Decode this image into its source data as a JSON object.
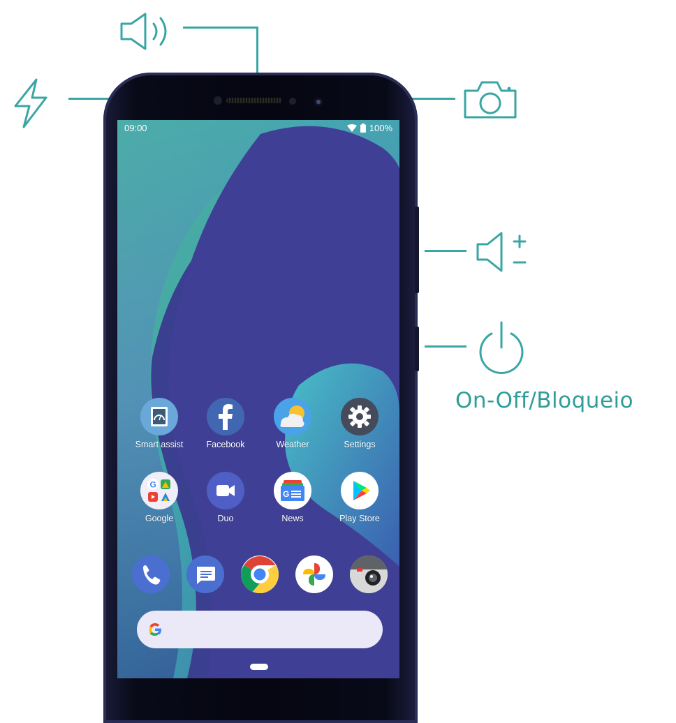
{
  "callouts": {
    "speaker_icon": "speaker-icon",
    "flash_icon": "flash-icon",
    "camera_icon": "camera-icon",
    "volume_icon": "volume-icon",
    "power_icon": "power-icon",
    "power_label": "On-Off/Bloqueio",
    "accent_color": "#3aa6a4"
  },
  "status_bar": {
    "time": "09:00",
    "battery": "100%",
    "wifi_icon": "wifi-icon",
    "battery_icon": "battery-icon"
  },
  "apps_row1": [
    {
      "label": "Smart assist",
      "icon": "smart-assist-icon"
    },
    {
      "label": "Facebook",
      "icon": "facebook-icon"
    },
    {
      "label": "Weather",
      "icon": "weather-icon"
    },
    {
      "label": "Settings",
      "icon": "settings-icon"
    }
  ],
  "apps_row2": [
    {
      "label": "Google",
      "icon": "google-folder-icon"
    },
    {
      "label": "Duo",
      "icon": "duo-icon"
    },
    {
      "label": "News",
      "icon": "news-icon"
    },
    {
      "label": "Play Store",
      "icon": "play-store-icon"
    }
  ],
  "dock": [
    {
      "icon": "phone-icon"
    },
    {
      "icon": "messages-icon"
    },
    {
      "icon": "chrome-icon"
    },
    {
      "icon": "photos-icon"
    },
    {
      "icon": "camera-app-icon"
    }
  ],
  "search": {
    "icon": "google-g-icon"
  }
}
